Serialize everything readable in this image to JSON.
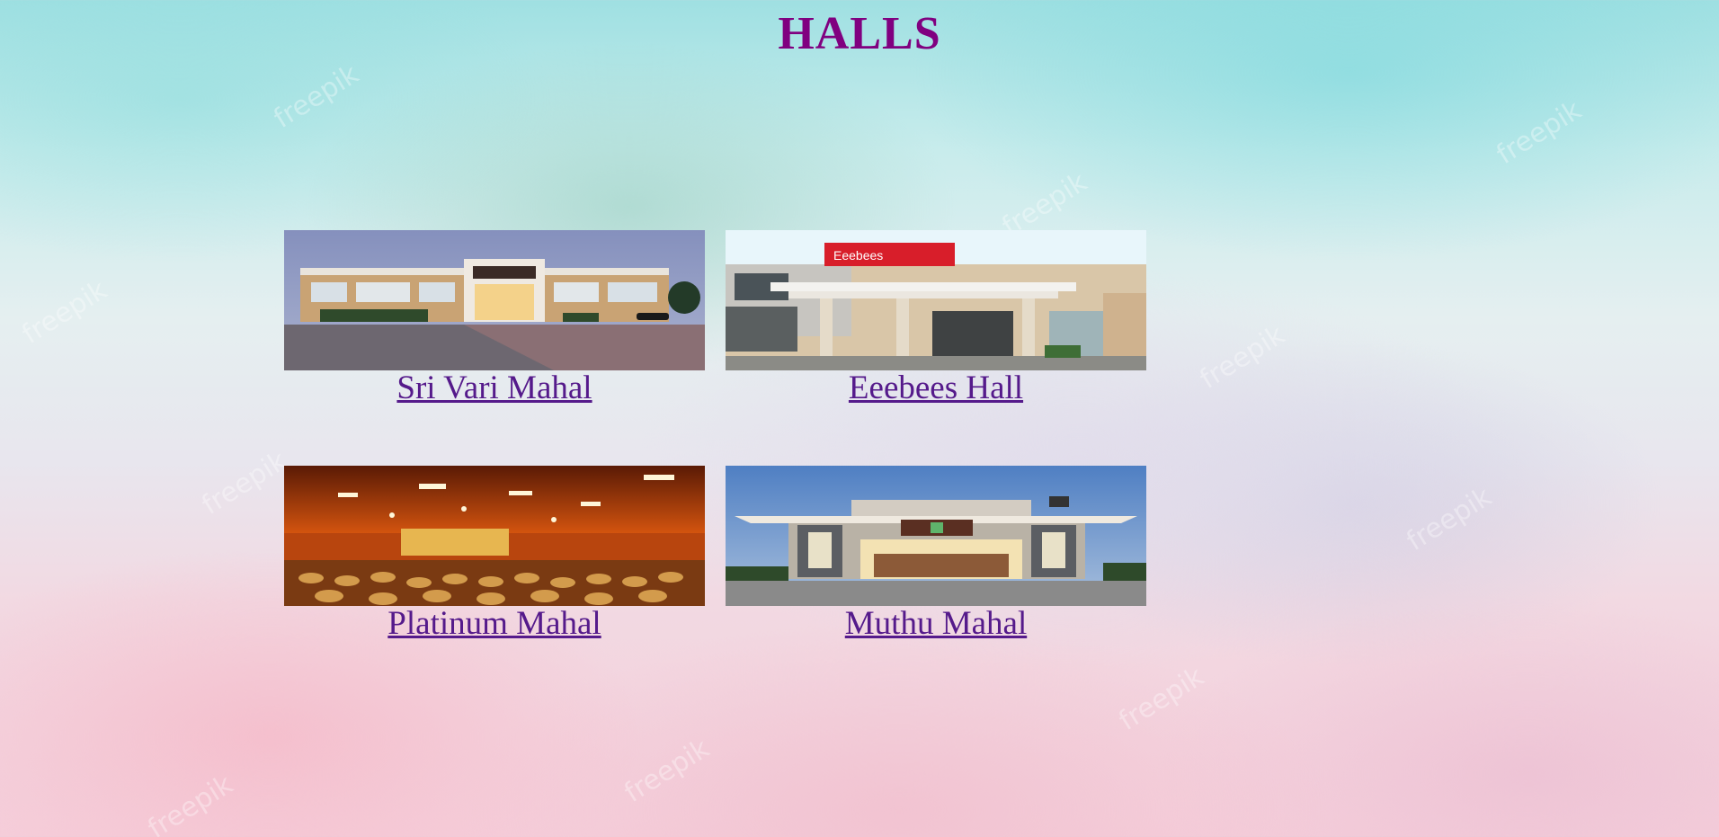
{
  "page": {
    "title": "HALLS"
  },
  "halls": [
    {
      "name": "Sri Vari Mahal"
    },
    {
      "name": "Eeebees Hall"
    },
    {
      "name": "Platinum Mahal"
    },
    {
      "name": "Muthu Mahal"
    }
  ],
  "photo_signage": {
    "eeebees_sign": "Eeebees"
  },
  "background": {
    "watermark": "freepik"
  },
  "colors": {
    "title": "#800080",
    "link": "#551a8b"
  }
}
